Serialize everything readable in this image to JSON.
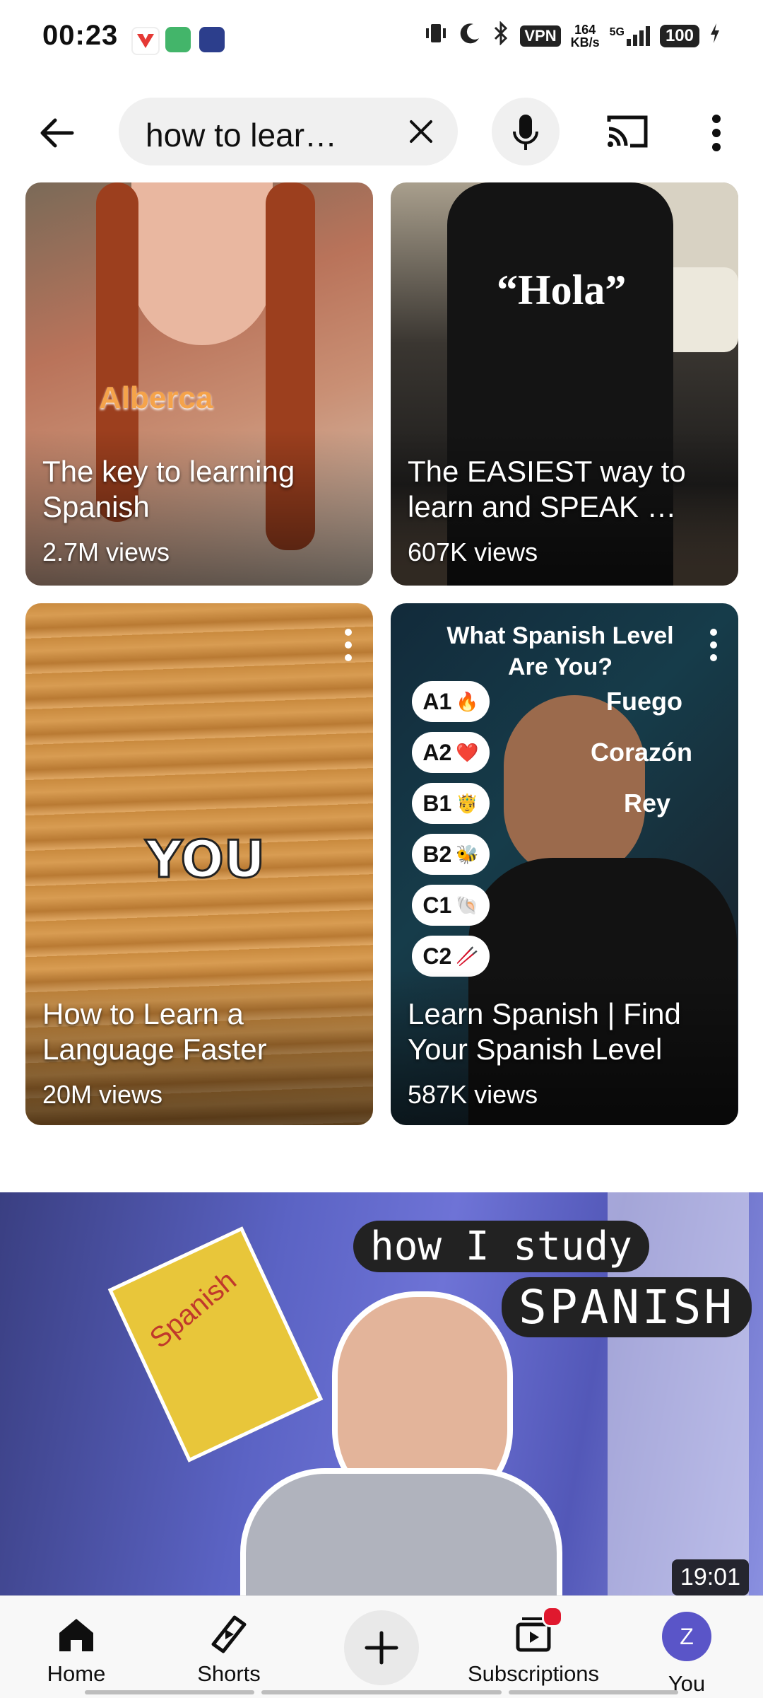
{
  "status_bar": {
    "time": "00:23",
    "vpn": "VPN",
    "speed_value": "164",
    "speed_unit": "KB/s",
    "network": "5G",
    "battery": "100"
  },
  "search": {
    "query": "how to lear…"
  },
  "shorts": [
    {
      "title": "The key to learning Spanish",
      "views": "2.7M views",
      "overlay": "Alberca"
    },
    {
      "title": "The EASIEST way to learn and SPEAK …",
      "views": "607K views",
      "overlay": "“Hola”"
    },
    {
      "title": "How to Learn a Language Faster",
      "views": "20M views",
      "overlay": "YOU"
    },
    {
      "title": "Learn Spanish | Find Your Spanish Level",
      "views": "587K views",
      "overlay_title": "What Spanish Level Are You?",
      "levels": [
        "A1",
        "A2",
        "B1",
        "B2",
        "C1",
        "C2"
      ],
      "level_emojis": [
        "🔥",
        "❤️",
        "🤴",
        "🐝",
        "🐚",
        "🥢"
      ],
      "words": [
        "Fuego",
        "Corazón",
        "Rey"
      ]
    }
  ],
  "video": {
    "overlay_line1": "how I study",
    "overlay_line2": "SPANISH",
    "book_title": "Spanish",
    "duration": "19:01"
  },
  "nav": {
    "home": "Home",
    "shorts": "Shorts",
    "subscriptions": "Subscriptions",
    "you": "You",
    "avatar_letter": "Z"
  },
  "colors": {
    "avatar": "#5a55c8",
    "notification_dot": "#e0182e",
    "video_bg": "#5b63c4"
  }
}
